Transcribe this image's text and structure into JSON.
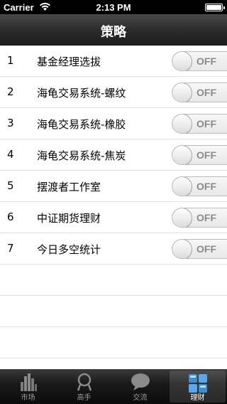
{
  "status_bar": {
    "carrier": "Carrier",
    "time": "2:13 PM"
  },
  "nav": {
    "title": "策略"
  },
  "strategies": [
    {
      "num": "1",
      "name": "基金经理选拔",
      "toggle": "OFF"
    },
    {
      "num": "2",
      "name": "海龟交易系统-螺纹",
      "toggle": "OFF"
    },
    {
      "num": "3",
      "name": "海龟交易系统-橡胶",
      "toggle": "OFF"
    },
    {
      "num": "4",
      "name": "海龟交易系统-焦炭",
      "toggle": "OFF"
    },
    {
      "num": "5",
      "name": "摆渡者工作室",
      "toggle": "OFF"
    },
    {
      "num": "6",
      "name": "中证期货理财",
      "toggle": "OFF"
    },
    {
      "num": "7",
      "name": "今日多空统计",
      "toggle": "OFF"
    }
  ],
  "tabs": [
    {
      "label": "市场",
      "icon": "bar-chart-icon"
    },
    {
      "label": "高手",
      "icon": "person-icon"
    },
    {
      "label": "交流",
      "icon": "chat-bubble-icon"
    },
    {
      "label": "理财",
      "icon": "grid-icon",
      "active": true
    }
  ],
  "colors": {
    "accent": "#3b8fd6",
    "nav_bg": "#2c2c2c",
    "tab_active_label": "#ffffff"
  }
}
